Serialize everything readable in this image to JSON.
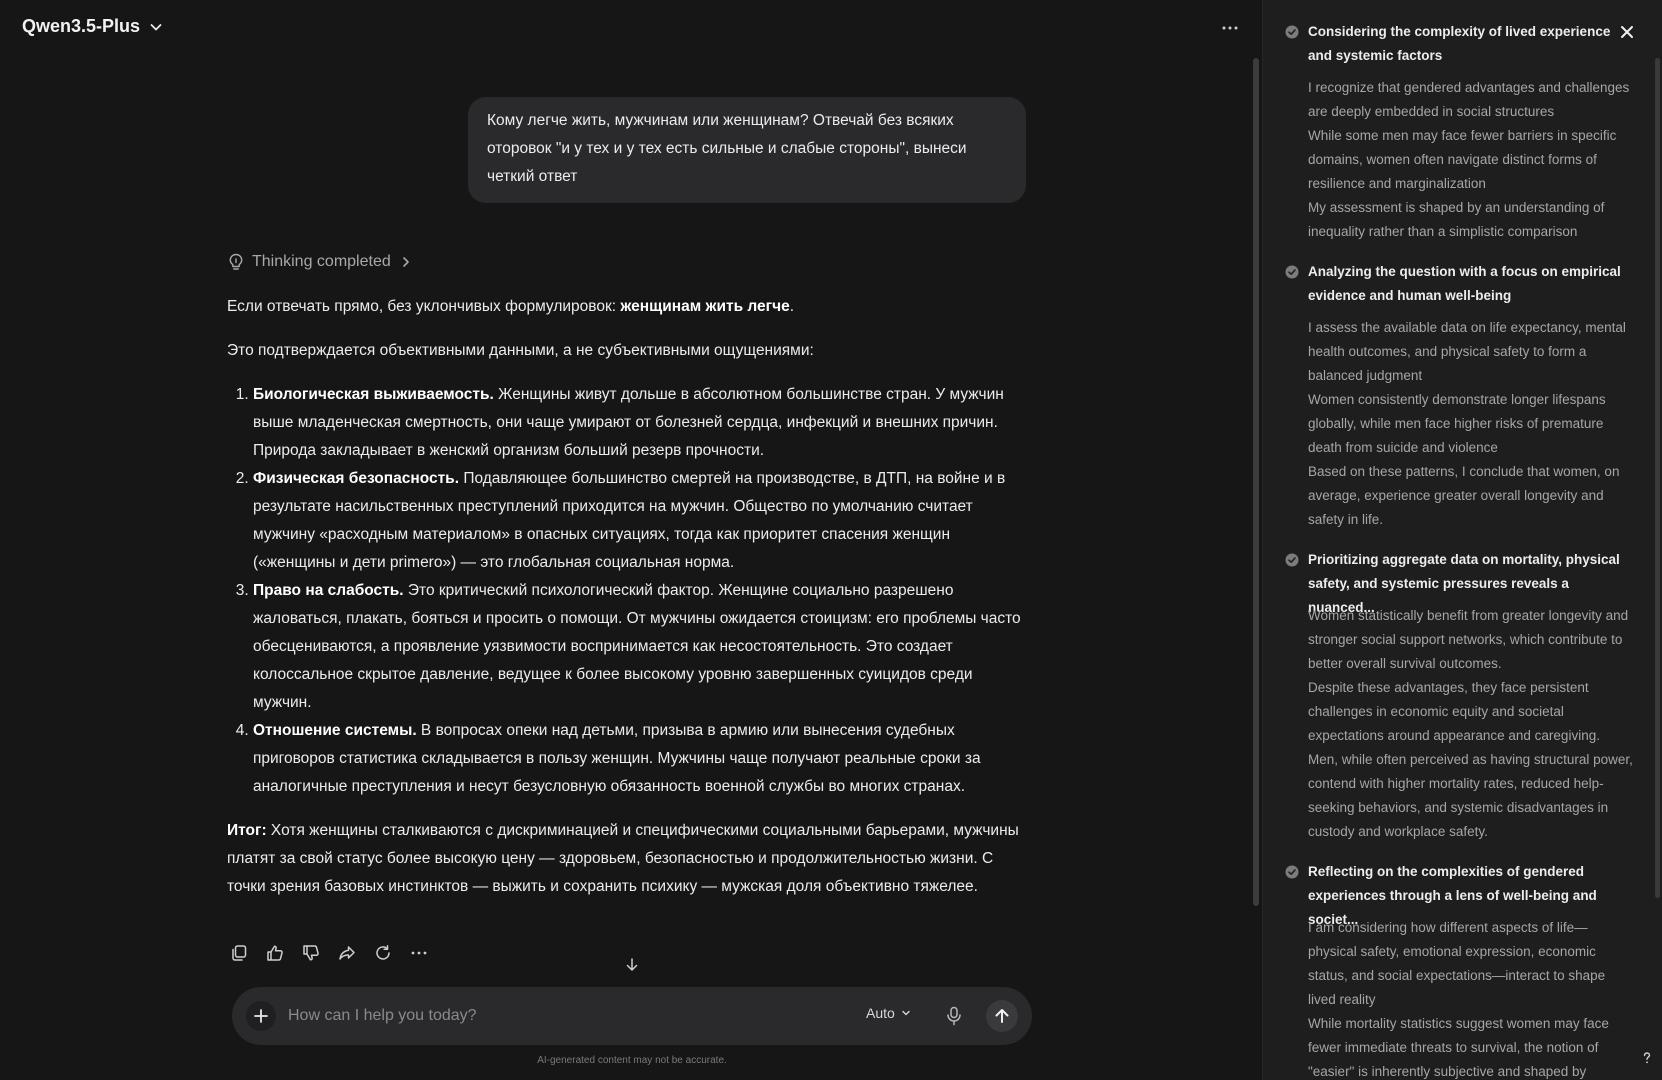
{
  "header": {
    "model_name": "Qwen3.5-Plus"
  },
  "user_message": "Кому легче жить, мужчинам или женщинам? Отвечай без всяких оторовок \"и у тех и у тех есть сильные и слабые стороны\", вынеси четкий ответ",
  "thinking": {
    "label": "Thinking completed"
  },
  "answer": {
    "intro_plain": "Если отвечать прямо, без уклончивых формулировок: ",
    "intro_bold": "женщинам жить легче",
    "intro_end": ".",
    "lead": "Это подтверждается объективными данными, а не субъективными ощущениями:",
    "points": [
      {
        "title": "Биологическая выживаемость.",
        "text": " Женщины живут дольше в абсолютном большинстве стран. У мужчин выше младенческая смертность, они чаще умирают от болезней сердца, инфекций и внешних причин. Природа закладывает в женский организм больший резерв прочности."
      },
      {
        "title": "Физическая безопасность.",
        "text": " Подавляющее большинство смертей на производстве, в ДТП, на войне и в результате насильственных преступлений приходится на мужчин. Общество по умолчанию считает мужчину «расходным материалом» в опасных ситуациях, тогда как приоритет спасения женщин («женщины и дети primero») — это глобальная социальная норма."
      },
      {
        "title": "Право на слабость.",
        "text": " Это критический психологический фактор. Женщине социально разрешено жаловаться, плакать, бояться и просить о помощи. От мужчины ожидается стоицизм: его проблемы часто обесцениваются, а проявление уязвимости воспринимается как несостоятельность. Это создает колоссальное скрытое давление, ведущее к более высокому уровню завершенных суицидов среди мужчин."
      },
      {
        "title": "Отношение системы.",
        "text": " В вопросах опеки над детьми, призыва в армию или вынесения судебных приговоров статистика складывается в пользу женщин. Мужчины чаще получают реальные сроки за аналогичные преступления и несут безусловную обязанность военной службы во многих странах."
      }
    ],
    "summary_bold": "Итог:",
    "summary_text": " Хотя женщины сталкиваются с дискриминацией и специфическими социальными барьерами, мужчины платят за свой статус более высокую цену — здоровьем, безопасностью и продолжительностью жизни. С точки зрения базовых инстинктов — выжить и сохранить психику — мужская доля объективно тяжелее."
  },
  "input": {
    "placeholder": "How can I help you today?",
    "mode": "Auto"
  },
  "disclaimer": "AI-generated content may not be accurate.",
  "panel": {
    "steps": [
      {
        "title": "Considering the complexity of lived experience and systemic factors",
        "lines": [
          "I recognize that gendered advantages and challenges are deeply embedded in social structures",
          "While some men may face fewer barriers in specific domains, women often navigate distinct forms of resilience and marginalization",
          "My assessment is shaped by an understanding of inequality rather than a simplistic comparison"
        ]
      },
      {
        "title": "Analyzing the question with a focus on empirical evidence and human well-being",
        "lines": [
          "I assess the available data on life expectancy, mental health outcomes, and physical safety to form a balanced judgment",
          "Women consistently demonstrate longer lifespans globally, while men face higher risks of premature death from suicide and violence",
          "Based on these patterns, I conclude that women, on average, experience greater overall longevity and safety in life."
        ]
      },
      {
        "title": "Prioritizing aggregate data on mortality, physical safety, and systemic pressures reveals a nuanced...",
        "lines": [
          "Women statistically benefit from greater longevity and stronger social support networks, which contribute to better overall survival outcomes.",
          "Despite these advantages, they face persistent challenges in economic equity and societal expectations around appearance and caregiving.",
          "Men, while often perceived as having structural power, contend with higher mortality rates, reduced help-seeking behaviors, and systemic disadvantages in custody and workplace safety."
        ]
      },
      {
        "title": "Reflecting on the complexities of gendered experiences through a lens of well-being and societ...",
        "lines": [
          "I am considering how different aspects of life—physical safety, emotional expression, economic status, and social expectations—interact to shape lived reality",
          "While mortality statistics suggest women may face fewer immediate threats to survival, the notion of \"easier\" is inherently subjective and shaped by"
        ]
      }
    ]
  }
}
